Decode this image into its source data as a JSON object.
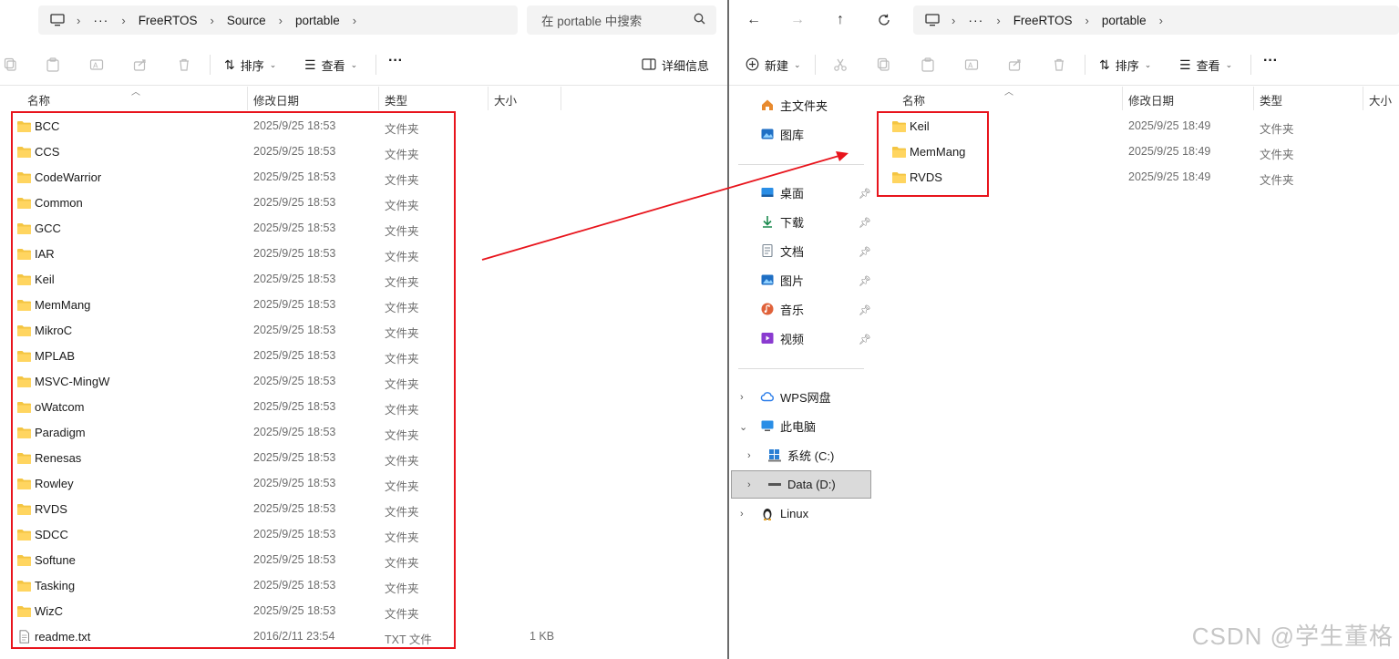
{
  "left": {
    "breadcrumb": [
      "FreeRTOS",
      "Source",
      "portable"
    ],
    "search_placeholder": "在 portable 中搜索",
    "toolbar": {
      "sort": "排序",
      "view": "查看",
      "more": "···",
      "details": "详细信息"
    },
    "columns": {
      "name": "名称",
      "date": "修改日期",
      "type": "类型",
      "size": "大小"
    },
    "rows": [
      {
        "name": "BCC",
        "date": "2025/9/25 18:53",
        "type": "文件夹",
        "size": "",
        "kind": "folder"
      },
      {
        "name": "CCS",
        "date": "2025/9/25 18:53",
        "type": "文件夹",
        "size": "",
        "kind": "folder"
      },
      {
        "name": "CodeWarrior",
        "date": "2025/9/25 18:53",
        "type": "文件夹",
        "size": "",
        "kind": "folder"
      },
      {
        "name": "Common",
        "date": "2025/9/25 18:53",
        "type": "文件夹",
        "size": "",
        "kind": "folder"
      },
      {
        "name": "GCC",
        "date": "2025/9/25 18:53",
        "type": "文件夹",
        "size": "",
        "kind": "folder"
      },
      {
        "name": "IAR",
        "date": "2025/9/25 18:53",
        "type": "文件夹",
        "size": "",
        "kind": "folder"
      },
      {
        "name": "Keil",
        "date": "2025/9/25 18:53",
        "type": "文件夹",
        "size": "",
        "kind": "folder"
      },
      {
        "name": "MemMang",
        "date": "2025/9/25 18:53",
        "type": "文件夹",
        "size": "",
        "kind": "folder"
      },
      {
        "name": "MikroC",
        "date": "2025/9/25 18:53",
        "type": "文件夹",
        "size": "",
        "kind": "folder"
      },
      {
        "name": "MPLAB",
        "date": "2025/9/25 18:53",
        "type": "文件夹",
        "size": "",
        "kind": "folder"
      },
      {
        "name": "MSVC-MingW",
        "date": "2025/9/25 18:53",
        "type": "文件夹",
        "size": "",
        "kind": "folder"
      },
      {
        "name": "oWatcom",
        "date": "2025/9/25 18:53",
        "type": "文件夹",
        "size": "",
        "kind": "folder"
      },
      {
        "name": "Paradigm",
        "date": "2025/9/25 18:53",
        "type": "文件夹",
        "size": "",
        "kind": "folder"
      },
      {
        "name": "Renesas",
        "date": "2025/9/25 18:53",
        "type": "文件夹",
        "size": "",
        "kind": "folder"
      },
      {
        "name": "Rowley",
        "date": "2025/9/25 18:53",
        "type": "文件夹",
        "size": "",
        "kind": "folder"
      },
      {
        "name": "RVDS",
        "date": "2025/9/25 18:53",
        "type": "文件夹",
        "size": "",
        "kind": "folder"
      },
      {
        "name": "SDCC",
        "date": "2025/9/25 18:53",
        "type": "文件夹",
        "size": "",
        "kind": "folder"
      },
      {
        "name": "Softune",
        "date": "2025/9/25 18:53",
        "type": "文件夹",
        "size": "",
        "kind": "folder"
      },
      {
        "name": "Tasking",
        "date": "2025/9/25 18:53",
        "type": "文件夹",
        "size": "",
        "kind": "folder"
      },
      {
        "name": "WizC",
        "date": "2025/9/25 18:53",
        "type": "文件夹",
        "size": "",
        "kind": "folder"
      },
      {
        "name": "readme.txt",
        "date": "2016/2/11 23:54",
        "type": "TXT 文件",
        "size": "1 KB",
        "kind": "file"
      }
    ]
  },
  "right": {
    "breadcrumb": [
      "FreeRTOS",
      "portable"
    ],
    "toolbar": {
      "new": "新建",
      "sort": "排序",
      "view": "查看",
      "more": "···"
    },
    "columns": {
      "name": "名称",
      "date": "修改日期",
      "type": "类型",
      "size": "大小"
    },
    "rows": [
      {
        "name": "Keil",
        "date": "2025/9/25 18:49",
        "type": "文件夹"
      },
      {
        "name": "MemMang",
        "date": "2025/9/25 18:49",
        "type": "文件夹"
      },
      {
        "name": "RVDS",
        "date": "2025/9/25 18:49",
        "type": "文件夹"
      }
    ],
    "nav": {
      "home": "主文件夹",
      "gallery": "图库",
      "pinned": [
        "桌面",
        "下载",
        "文档",
        "图片",
        "音乐",
        "视频"
      ],
      "wps": "WPS网盘",
      "this_pc": "此电脑",
      "drive_c": "系统 (C:)",
      "drive_d": "Data (D:)",
      "linux": "Linux"
    }
  },
  "watermark": "CSDN @学生董格",
  "colors": {
    "highlight": "#e8141c",
    "folder": "#f4c542",
    "selection": "#dadada"
  }
}
